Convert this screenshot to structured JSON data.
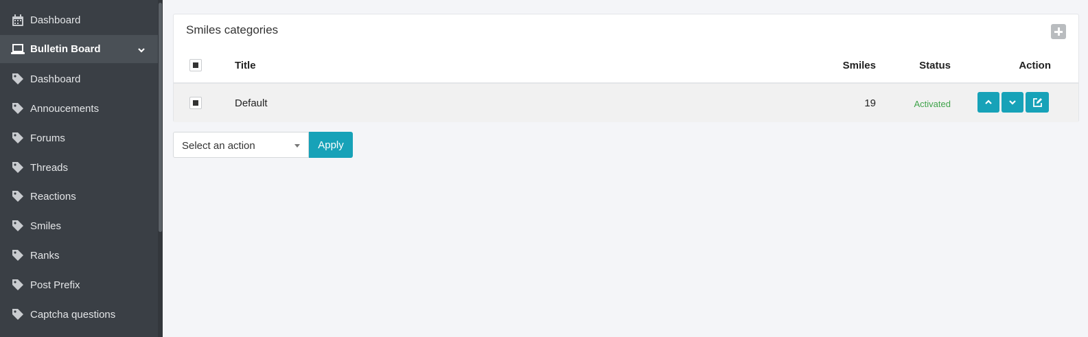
{
  "sidebar": {
    "items": [
      {
        "label": "Dashboard",
        "icon": "calendar-icon"
      },
      {
        "label": "Bulletin Board",
        "icon": "laptop-icon",
        "active": true
      },
      {
        "label": "Dashboard",
        "icon": "tag-icon"
      },
      {
        "label": "Annoucements",
        "icon": "tag-icon"
      },
      {
        "label": "Forums",
        "icon": "tag-icon"
      },
      {
        "label": "Threads",
        "icon": "tag-icon"
      },
      {
        "label": "Reactions",
        "icon": "tag-icon"
      },
      {
        "label": "Smiles",
        "icon": "tag-icon"
      },
      {
        "label": "Ranks",
        "icon": "tag-icon"
      },
      {
        "label": "Post Prefix",
        "icon": "tag-icon"
      },
      {
        "label": "Captcha questions",
        "icon": "tag-icon"
      }
    ]
  },
  "card": {
    "title": "Smiles categories",
    "columns": {
      "title": "Title",
      "smiles": "Smiles",
      "status": "Status",
      "action": "Action"
    },
    "rows": [
      {
        "title": "Default",
        "smiles": "19",
        "status": "Activated"
      }
    ]
  },
  "bulk": {
    "select_value": "Select an action",
    "apply_label": "Apply"
  },
  "colors": {
    "sidebar_bg": "#3a3f45",
    "accent": "#17a2b8",
    "status_active": "#3fa34a"
  }
}
